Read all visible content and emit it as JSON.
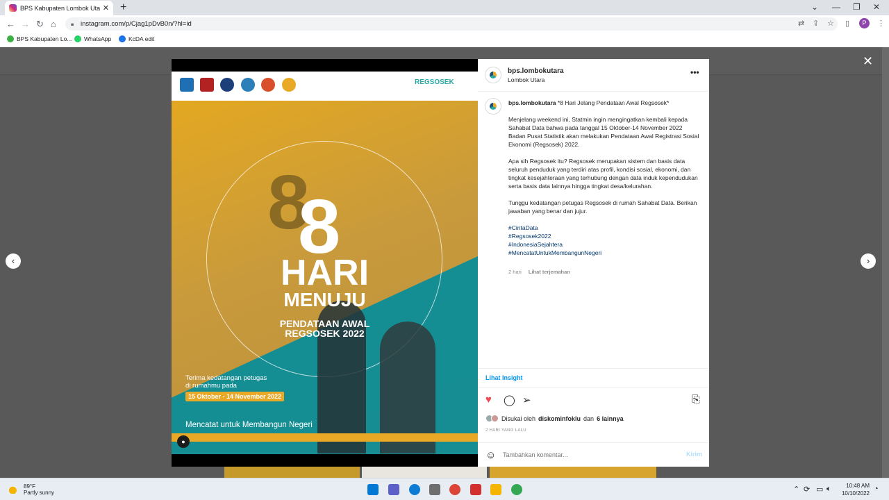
{
  "browser": {
    "tab_title": "BPS Kabupaten Lombok Utara (@",
    "url": "instagram.com/p/Cjag1pDvB0n/?hl=id",
    "bookmarks": [
      "BPS Kabupaten Lo...",
      "WhatsApp",
      "KcDA edit"
    ],
    "profile_initial": "P"
  },
  "poster": {
    "brand": "REGSOSEK",
    "big_number": "8",
    "shadow_number": "8",
    "hari": "HARI",
    "menuju": "MENUJU",
    "pendataan": "PENDATAAN AWAL",
    "regsosek_year": "REGSOSEK 2022",
    "terima_line1": "Terima kedatangan petugas",
    "terima_line2": "di rumahmu pada",
    "date_range": "15 Oktober - 14 November 2022",
    "tagline": "Mencatat untuk Membangun Negeri"
  },
  "post": {
    "username": "bps.lombokutara",
    "location": "Lombok Utara",
    "caption_title": "*8 Hari Jelang Pendataan Awal Regsosek*",
    "paragraph1": "Menjelang weekend ini, Statmin ingin mengingatkan kembali kepada Sahabat Data bahwa pada tanggal 15 Oktober-14 November 2022 Badan Pusat Statistik akan melakukan Pendataan Awal Registrasi Sosial Ekonomi (Regsosek) 2022.",
    "paragraph2": "Apa sih Regsosek itu? Regsosek merupakan sistem dan basis data seluruh penduduk yang terdiri atas profil, kondisi sosial, ekonomi, dan tingkat kesejahteraan yang terhubung dengan data induk kependudukan serta basis data lainnya hingga tingkat desa/kelurahan.",
    "paragraph3": "Tunggu kedatangan petugas Regsosek di rumah Sahabat Data. Berikan jawaban yang benar dan jujur.",
    "hashtags": [
      "#CintaData",
      "#Regsosek2022",
      "#IndonesiaSejahtera",
      "#MencatatUntukMembangunNegeri"
    ],
    "time": "2 hari",
    "translate": "Lihat terjemahan",
    "insight": "Lihat Insight",
    "liked_prefix": "Disukai oleh",
    "liked_user": "diskominfoklu",
    "liked_and": "dan",
    "liked_others": "6 lainnya",
    "time_ago": "2 HARI YANG LALU",
    "comment_placeholder": "Tambahkan komentar...",
    "send": "Kirim"
  },
  "taskbar": {
    "temp": "89°F",
    "weather": "Partly sunny",
    "time": "10:48 AM",
    "date": "10/10/2022"
  },
  "colors": {
    "accent_blue": "#0095f6",
    "gold": "#e9a826",
    "teal": "#0c8d98",
    "like_red": "#ed4956"
  }
}
